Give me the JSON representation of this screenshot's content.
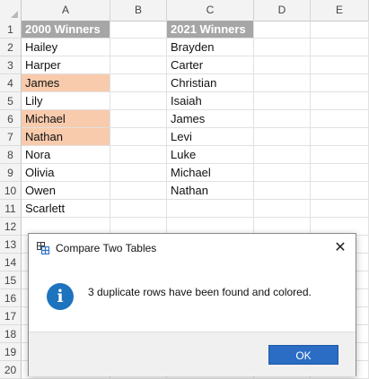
{
  "sheet": {
    "columns": [
      "A",
      "B",
      "C",
      "D",
      "E"
    ],
    "rows": [
      "1",
      "2",
      "3",
      "4",
      "5",
      "6",
      "7",
      "8",
      "9",
      "10",
      "11",
      "12",
      "13",
      "14",
      "15",
      "16",
      "17",
      "18",
      "19",
      "20"
    ],
    "col_a_header": "2000 Winners",
    "col_c_header": "2021 Winners",
    "col_a_values": [
      "Hailey",
      "Harper",
      "James",
      "Lily",
      "Michael",
      "Nathan",
      "Nora",
      "Olivia",
      "Owen",
      "Scarlett"
    ],
    "col_c_values": [
      "Brayden",
      "Carter",
      "Christian",
      "Isaiah",
      "James",
      "Levi",
      "Luke",
      "Michael",
      "Nathan"
    ],
    "highlighted_values": [
      "James",
      "Michael",
      "Nathan"
    ],
    "colors": {
      "header_bg": "#a6a6a6",
      "highlight": "#f8cbad"
    }
  },
  "dialog": {
    "title": "Compare Two Tables",
    "title_icon": "compare-tables-icon",
    "close_glyph": "✕",
    "icon": "info-icon",
    "icon_glyph": "i",
    "message": "3 duplicate rows have been found and colored.",
    "ok_label": "OK",
    "accent": "#2b6cc4"
  }
}
